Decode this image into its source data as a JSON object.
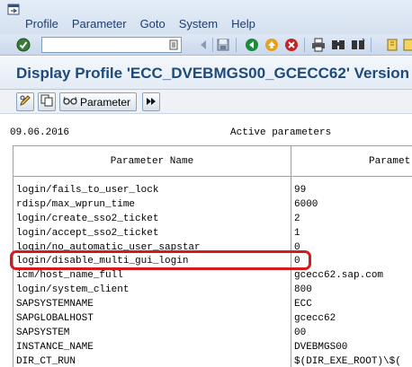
{
  "menu": {
    "items": [
      "Profile",
      "Parameter",
      "Goto",
      "System",
      "Help"
    ]
  },
  "toolbar": {
    "command_value": ""
  },
  "title": "Display Profile 'ECC_DVEBMGS00_GCECC62' Version",
  "app_toolbar": {
    "parameter_label": "Parameter"
  },
  "content": {
    "date": "09.06.2016",
    "heading": "Active parameters"
  },
  "table": {
    "columns": [
      "Parameter Name",
      "Paramet"
    ],
    "rows": [
      {
        "name": "login/fails_to_user_lock",
        "value": "99"
      },
      {
        "name": "rdisp/max_wprun_time",
        "value": "6000"
      },
      {
        "name": "login/create_sso2_ticket",
        "value": "2"
      },
      {
        "name": "login/accept_sso2_ticket",
        "value": "1"
      },
      {
        "name": "login/no_automatic_user_sapstar",
        "value": "0"
      },
      {
        "name": "login/disable_multi_gui_login",
        "value": "0"
      },
      {
        "name": "icm/host_name_full",
        "value": "gcecc62.sap.com"
      },
      {
        "name": "login/system_client",
        "value": "800"
      },
      {
        "name": "SAPSYSTEMNAME",
        "value": "ECC"
      },
      {
        "name": "SAPGLOBALHOST",
        "value": "gcecc62"
      },
      {
        "name": "SAPSYSTEM",
        "value": "00"
      },
      {
        "name": "INSTANCE_NAME",
        "value": "DVEBMGS00"
      },
      {
        "name": "DIR_CT_RUN",
        "value": "$(DIR_EXE_ROOT)\\$("
      }
    ]
  },
  "colors": {
    "title": "#1e4a7c",
    "menu_text": "#1d3e6e",
    "highlight": "#d41a1a"
  }
}
